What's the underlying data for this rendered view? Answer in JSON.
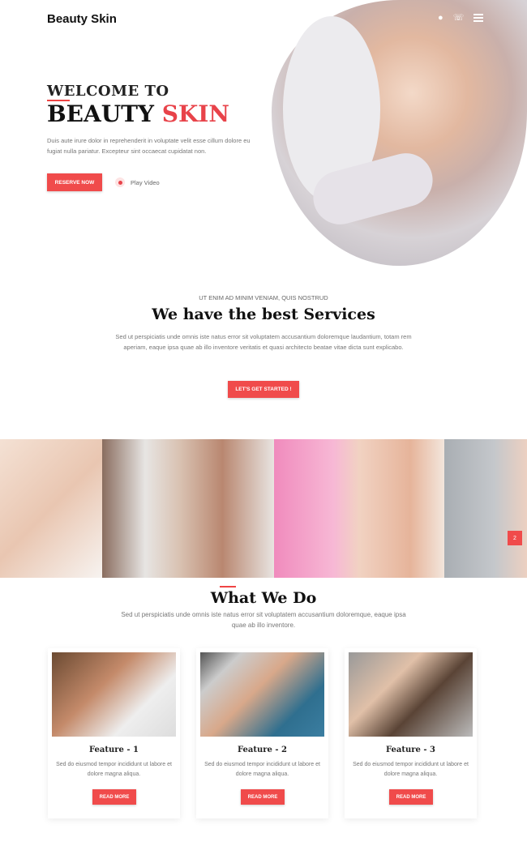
{
  "header": {
    "logo": "Beauty Skin",
    "icons": [
      "search-icon",
      "phone-icon",
      "menu-icon"
    ]
  },
  "hero": {
    "line1": "WELCOME TO",
    "line2a": "BEAUTY",
    "line2b": "SKIN",
    "text": "Duis aute irure dolor in reprehenderit in voluptate velit esse cillum dolore eu fugiat nulla pariatur. Excepteur sint occaecat cupidatat non.",
    "reserve": "RESERVE NOW",
    "play": "Play Video"
  },
  "services": {
    "kicker": "UT ENIM AD MINIM VENIAM, QUIS NOSTRUD",
    "title": "We have the best Services",
    "text": "Sed ut perspiciatis unde omnis iste natus error sit voluptatem accusantium doloremque laudantium, totam rem aperiam, eaque ipsa quae ab illo inventore veritatis et quasi architecto beatae vitae dicta sunt explicabo.",
    "button": "LET'S GET STARTED !"
  },
  "gallery": {
    "next": "2"
  },
  "what": {
    "title": "What We Do",
    "text": "Sed ut perspiciatis unde omnis iste natus error sit voluptatem accusantium doloremque, eaque ipsa quae ab illo inventore.",
    "cards": [
      {
        "title": "Feature - 1",
        "text": "Sed do eiusmod tempor incididunt ut labore et dolore magna aliqua.",
        "button": "READ MORE"
      },
      {
        "title": "Feature - 2",
        "text": "Sed do eiusmod tempor incididunt ut labore et dolore magna aliqua.",
        "button": "READ MORE"
      },
      {
        "title": "Feature - 3",
        "text": "Sed do eiusmod tempor incididunt ut labore et dolore magna aliqua.",
        "button": "READ MORE"
      }
    ]
  },
  "colors": {
    "accent": "#f04b4b"
  }
}
